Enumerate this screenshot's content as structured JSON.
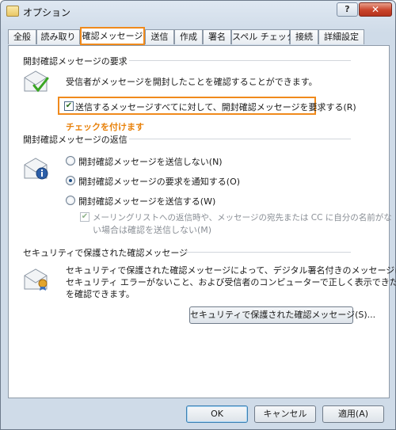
{
  "window": {
    "title": "オプション",
    "help_label": "?",
    "close_label": "✕"
  },
  "tabs": [
    {
      "label": "全般"
    },
    {
      "label": "読み取り"
    },
    {
      "label": "確認メッセージ"
    },
    {
      "label": "送信"
    },
    {
      "label": "作成"
    },
    {
      "label": "署名"
    },
    {
      "label": "スペル チェック"
    },
    {
      "label": "接続"
    },
    {
      "label": "詳細設定"
    }
  ],
  "read_receipt_request": {
    "heading": "開封確認メッセージの要求",
    "description": "受信者がメッセージを開封したことを確認することができます。",
    "checkbox_label": "送信するメッセージすべてに対して、開封確認メッセージを要求する(R)",
    "checked": true,
    "annotation": "チェックを付けます"
  },
  "read_receipt_reply": {
    "heading": "開封確認メッセージの返信",
    "options": [
      {
        "label": "開封確認メッセージを送信しない(N)",
        "selected": false
      },
      {
        "label": "開封確認メッセージの要求を通知する(O)",
        "selected": true
      },
      {
        "label": "開封確認メッセージを送信する(W)",
        "selected": false
      }
    ],
    "sub_checkbox_line1": "メーリングリストへの返信時や、メッセージの宛先または CC に自分の名前がな",
    "sub_checkbox_line2": "い場合は確認を送信しない(M)"
  },
  "secure_receipt": {
    "heading": "セキュリティで保護された確認メッセージ",
    "line1": "セキュリティで保護された確認メッセージによって、デジタル署名付きのメッセージに",
    "line2": "セキュリティ エラーがないこと、および受信者のコンピューターで正しく表示できたこと",
    "line3": "を確認できます。",
    "button_label": "セキュリティで保護された確認メッセージ(S)..."
  },
  "footer": {
    "ok": "OK",
    "cancel": "キャンセル",
    "apply": "適用(A)"
  },
  "colors": {
    "highlight": "#f08a1c",
    "checkmark": "#3aa623"
  },
  "icons": [
    "envelope-check-icon",
    "envelope-info-icon",
    "envelope-certificate-icon"
  ]
}
